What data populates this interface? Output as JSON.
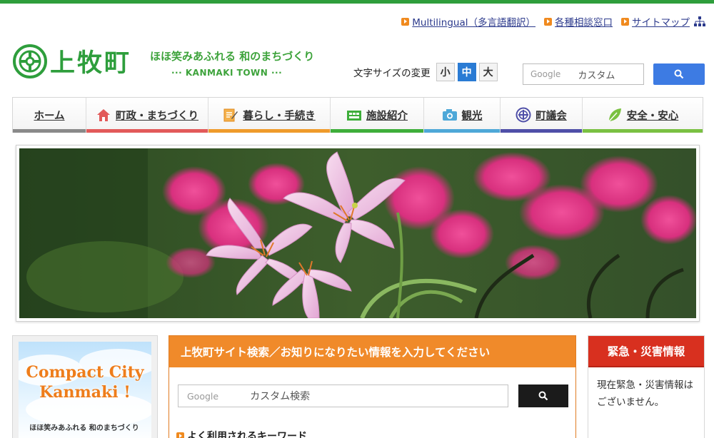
{
  "header": {
    "util_links": [
      {
        "label": "Multilingual（多言語翻訳）"
      },
      {
        "label": "各種相談窓口"
      },
      {
        "label": "サイトマップ"
      }
    ],
    "logo": {
      "town_name": "上牧町",
      "catchphrase": "ほほ笑みあふれる 和のまちづくり",
      "english": "··· KANMAKI TOWN ···"
    },
    "font_size": {
      "label": "文字サイズの変更",
      "small": "小",
      "medium": "中",
      "large": "大",
      "selected": "中"
    },
    "search": {
      "brand": "Google",
      "placeholder": "カスタム"
    }
  },
  "nav": {
    "items": [
      {
        "label": "ホーム",
        "color": "#8a8a8a"
      },
      {
        "label": "町政・まちづくり",
        "color": "#e25a5a"
      },
      {
        "label": "暮らし・手続き",
        "color": "#ef9b2b"
      },
      {
        "label": "施設紹介",
        "color": "#3eae3a"
      },
      {
        "label": "観光",
        "color": "#4ea8d8"
      },
      {
        "label": "町議会",
        "color": "#4f4fa8"
      },
      {
        "label": "安全・安心",
        "color": "#7ac142"
      }
    ]
  },
  "banner": {
    "title_line1": "Compact City",
    "title_line2": "Kanmaki !",
    "catchphrase": "ほほ笑みあふれる 和のまちづくり"
  },
  "site_search": {
    "heading": "上牧町サイト検索／お知りになりたい情報を入力してください",
    "brand": "Google",
    "placeholder": "カスタム検索",
    "keywords_label": "よく利用されるキーワード"
  },
  "emergency": {
    "heading": "緊急・災害情報",
    "message": "現在緊急・災害情報はございません。"
  },
  "colors": {
    "brand_green": "#2e9e3c",
    "accent_orange": "#f08a2a",
    "emergency_red": "#d8301f",
    "search_blue": "#3d7be3"
  }
}
